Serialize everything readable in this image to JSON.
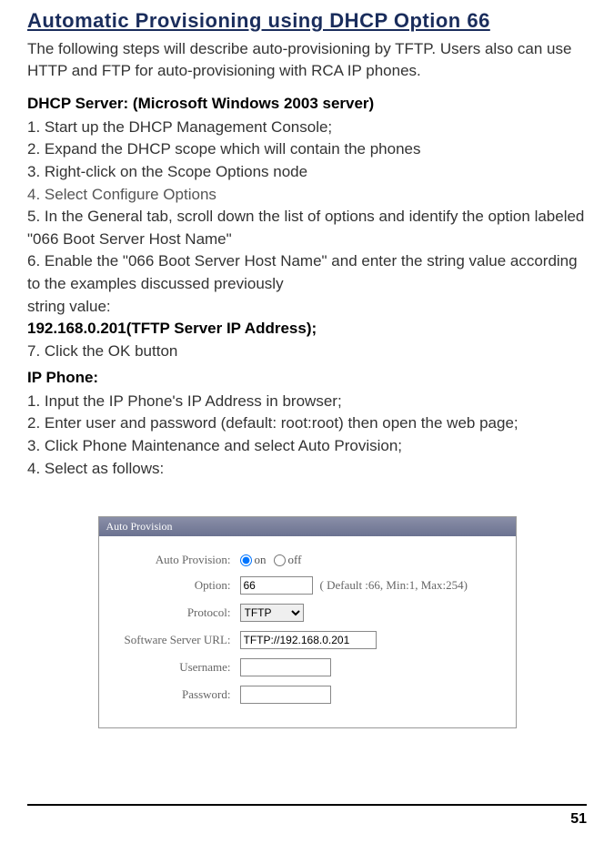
{
  "title": "Automatic Provisioning using DHCP Option 66",
  "intro": "The following steps will describe auto-provisioning by TFTP. Users also can use HTTP and FTP for auto-provisioning with RCA IP phones.",
  "dhcp": {
    "heading": "DHCP Server: (Microsoft Windows 2003 server)",
    "step1": "1. Start up the DHCP Management Console;",
    "step2": "2. Expand the DHCP scope which will contain the phones",
    "step3": "3. Right-click on the Scope Options node",
    "step4": "4. Select Configure Options",
    "step5": "5. In the General tab, scroll down the list of options and identify the option labeled \"066 Boot Server Host Name\"",
    "step6": "6. Enable the \"066 Boot Server Host Name\" and enter the string value according to the examples discussed previously",
    "stringValueLabel": "string value:",
    "stringValue": "192.168.0.201(TFTP Server IP Address);",
    "step7": "7. Click the OK button"
  },
  "ipphone": {
    "heading": "IP Phone:",
    "step1": "1. Input the IP Phone's IP Address in browser;",
    "step2": "2. Enter user and password (default: root:root) then open the web page;",
    "step3": "3. Click Phone Maintenance and select Auto Provision;",
    "step4": "4. Select as follows:"
  },
  "panel": {
    "header": "Auto Provision",
    "autoProvisionLabel": "Auto Provision:",
    "onLabel": "on",
    "offLabel": "off",
    "optionLabel": "Option:",
    "optionValue": "66",
    "optionNote": "( Default :66, Min:1, Max:254)",
    "protocolLabel": "Protocol:",
    "protocolValue": "TFTP",
    "serverUrlLabel": "Software Server URL:",
    "serverUrlValue": "TFTP://192.168.0.201",
    "usernameLabel": "Username:",
    "usernameValue": "",
    "passwordLabel": "Password:",
    "passwordValue": ""
  },
  "pageNumber": "51"
}
